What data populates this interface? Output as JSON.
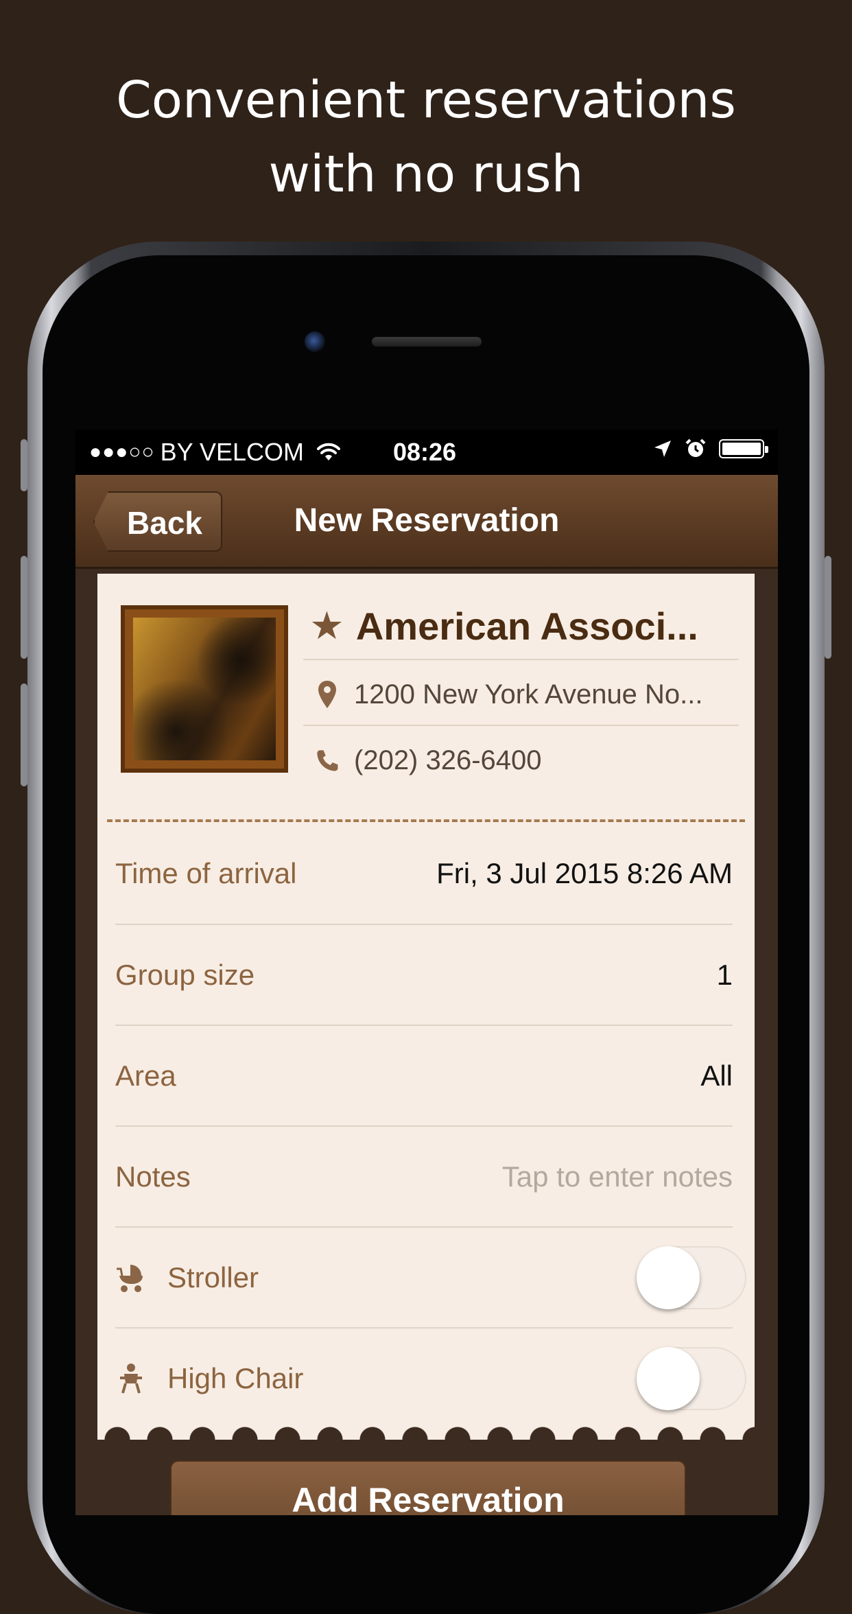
{
  "headline": {
    "line1": "Convenient reservations",
    "line2": "with no rush"
  },
  "status_bar": {
    "signal_dots": "●●●○○",
    "carrier": "BY VELCOM",
    "time": "08:26"
  },
  "nav": {
    "back_label": "Back",
    "title": "New Reservation"
  },
  "venue": {
    "name": "American Associ...",
    "address": "1200 New York Avenue No...",
    "phone": "(202) 326-6400"
  },
  "form": {
    "arrival_label": "Time of arrival",
    "arrival_value": "Fri, 3 Jul 2015 8:26 AM",
    "group_label": "Group size",
    "group_value": "1",
    "area_label": "Area",
    "area_value": "All",
    "notes_label": "Notes",
    "notes_placeholder": "Tap to enter notes",
    "stroller_label": "Stroller",
    "highchair_label": "High Chair"
  },
  "toggles": {
    "stroller_on": false,
    "highchair_on": false
  },
  "action": {
    "add_label": "Add Reservation"
  },
  "colors": {
    "background": "#2f2219",
    "navbar": "#5a3a22",
    "card": "#f7ede4",
    "label": "#8c6440",
    "venue_title": "#4a2c12"
  },
  "icons": [
    "signal-dots",
    "wifi-icon",
    "location-arrow-icon",
    "alarm-icon",
    "battery-icon",
    "star-icon",
    "map-pin-icon",
    "phone-icon",
    "stroller-icon",
    "high-chair-icon"
  ]
}
